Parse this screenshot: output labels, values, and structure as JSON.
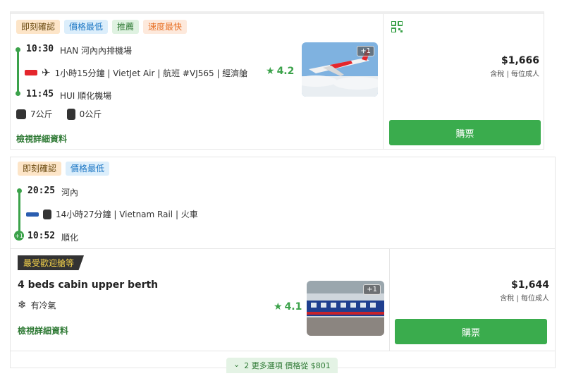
{
  "flight": {
    "tags": [
      "即刻確認",
      "價格最低",
      "推薦",
      "速度最快"
    ],
    "depart_time": "10:30",
    "depart_place": "HAN 河內內排機場",
    "duration_info": "1小時15分鐘 | VietJet Air | 航班 #VJ565 | 經濟艙",
    "rating": "4.2",
    "arrive_time": "11:45",
    "arrive_place": "HUI 順化機場",
    "carry_on": "7公斤",
    "checked": "0公斤",
    "details_link": "檢視詳細資料",
    "price": "$1,666",
    "price_note": "含稅 | 每位成人",
    "buy_label": "購票",
    "photo_more": "+1"
  },
  "train": {
    "tags": [
      "即刻確認",
      "價格最低"
    ],
    "depart_time": "20:25",
    "depart_place": "河內",
    "duration_info": "14小時27分鐘 | Vietnam Rail | 火車",
    "arrive_day_offset": "+1",
    "arrive_time": "10:52",
    "arrive_place": "順化",
    "popular_badge": "最受歡迎艙等",
    "cabin_title": "4 beds cabin upper berth",
    "amenity": "有冷氣",
    "rating": "4.1",
    "details_link": "檢視詳細資料",
    "price": "$1,644",
    "price_note": "含稅 | 每位成人",
    "buy_label": "購票",
    "photo_more": "+1",
    "more_options": "2 更多選項 價格從 $801"
  },
  "colors": {
    "accent_green": "#3aac4d",
    "airline_red": "#e4262c"
  }
}
